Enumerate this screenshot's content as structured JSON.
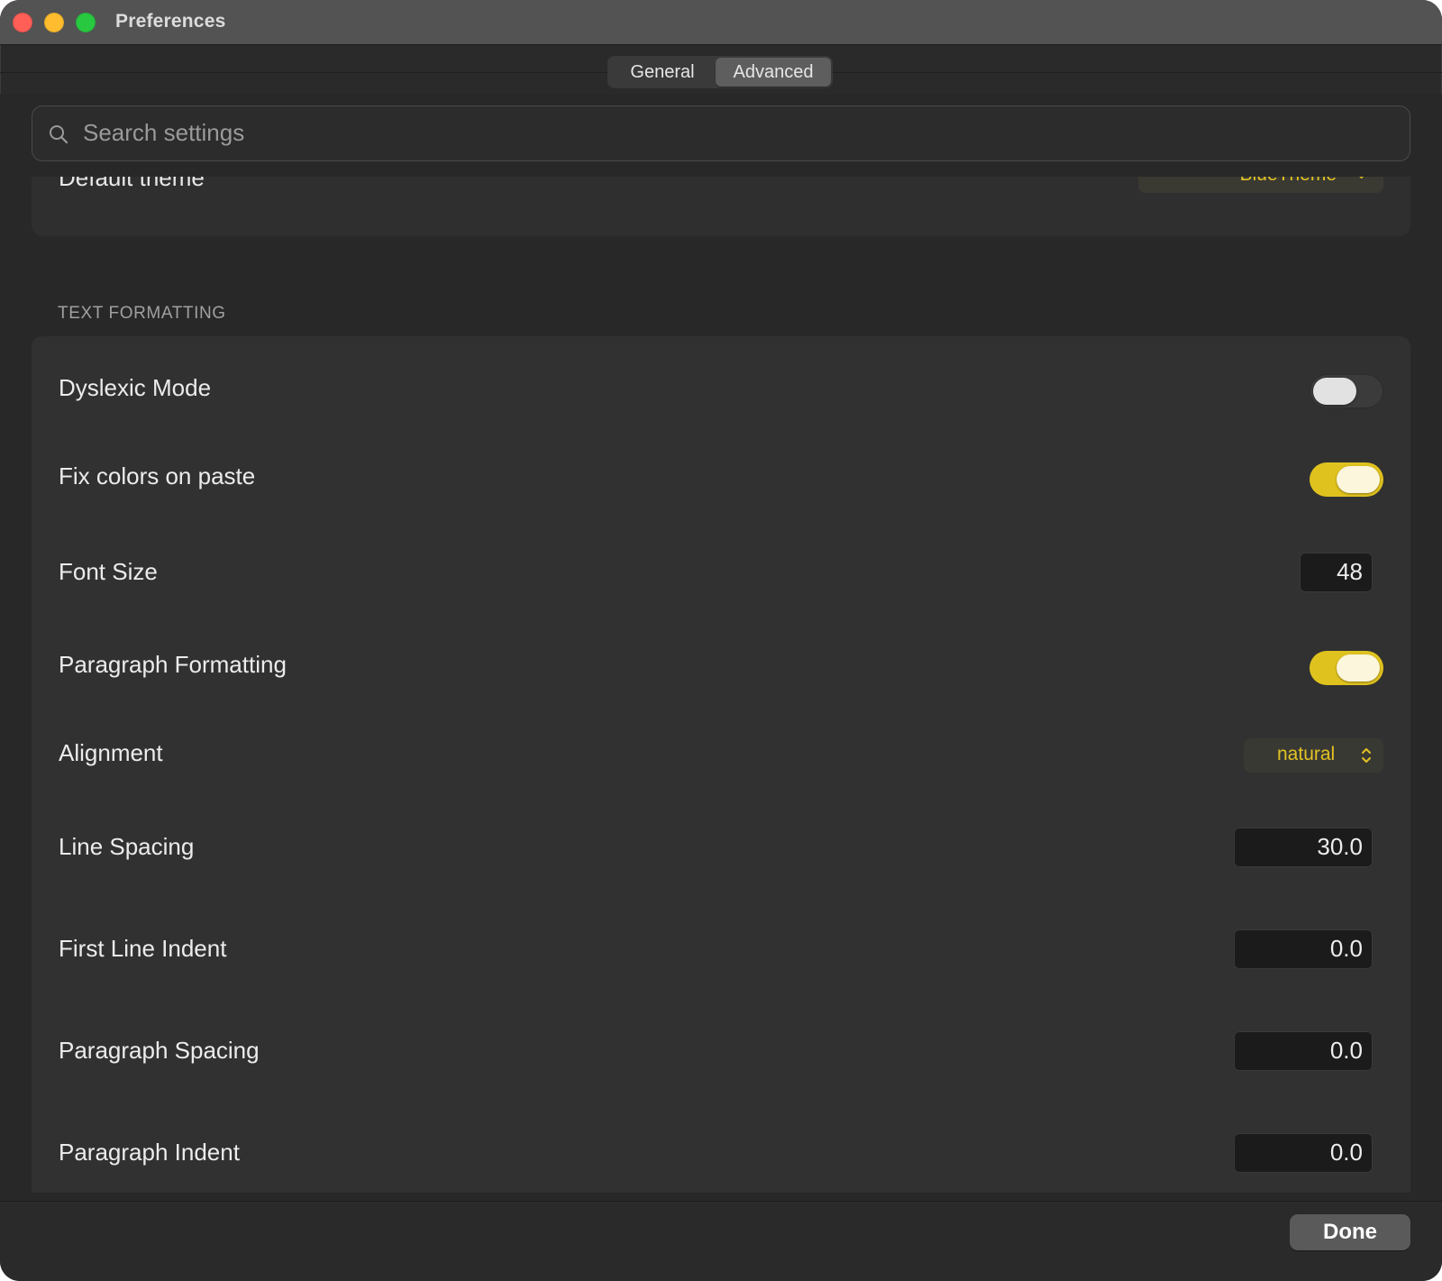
{
  "window": {
    "title": "Preferences"
  },
  "tabs": [
    {
      "label": "General",
      "selected": false
    },
    {
      "label": "Advanced",
      "selected": true
    }
  ],
  "search": {
    "placeholder": "Search settings"
  },
  "previous_section": {
    "row_label": "Default theme",
    "row_value": "BlueTheme"
  },
  "text_formatting": {
    "header": "TEXT FORMATTING",
    "rows": [
      {
        "label": "Dyslexic Mode",
        "control": "toggle",
        "on": false
      },
      {
        "label": "Fix colors on paste",
        "control": "toggle",
        "on": true
      },
      {
        "label": "Font Size",
        "control": "number",
        "value": "48"
      },
      {
        "label": "Paragraph Formatting",
        "control": "toggle",
        "on": true
      },
      {
        "label": "Alignment",
        "control": "popup",
        "value": "natural"
      },
      {
        "label": "Line Spacing",
        "control": "number",
        "value": "30.0"
      },
      {
        "label": "First Line Indent",
        "control": "number",
        "value": "0.0"
      },
      {
        "label": "Paragraph Spacing",
        "control": "number",
        "value": "0.0"
      },
      {
        "label": "Paragraph Indent",
        "control": "number",
        "value": "0.0"
      }
    ]
  },
  "footer": {
    "done_label": "Done"
  },
  "colors": {
    "accent": "#e0c21f",
    "accent_text": "#e3c224",
    "background": "#282828",
    "card": "#313131"
  },
  "icons": {
    "search": "search-icon",
    "popup_chevron": "chevron-up-down-icon",
    "close": "close-icon",
    "minimize": "minimize-icon",
    "zoom": "zoom-icon"
  }
}
